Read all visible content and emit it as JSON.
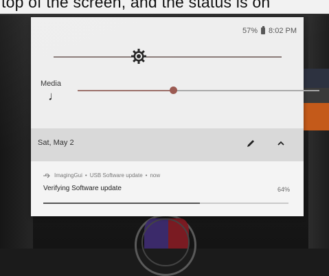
{
  "caption": {
    "text": "top of the screen, and the status is on"
  },
  "status_bar": {
    "battery": "57%",
    "time": "8:02 PM",
    "battery_icon": "battery-icon"
  },
  "brightness": {
    "icon": "brightness-icon",
    "level": 0.38
  },
  "media": {
    "label": "Media",
    "icon": "music-note-icon",
    "level": 0.39
  },
  "quick_settings": {
    "date": "Sat, May 2",
    "edit_icon": "pencil-icon",
    "collapse_icon": "chevron-up-icon"
  },
  "notification": {
    "app_icon": "usb-icon",
    "app": "ImagingGui",
    "separator": "•",
    "channel": "USB Software update",
    "time": "now",
    "title": "Verifying Software update",
    "percent": "64%",
    "progress": 0.64
  },
  "colors": {
    "shade_bg": "#eeeeee",
    "accent_thumb": "#9b5a52",
    "orange": "#c45a1a"
  }
}
